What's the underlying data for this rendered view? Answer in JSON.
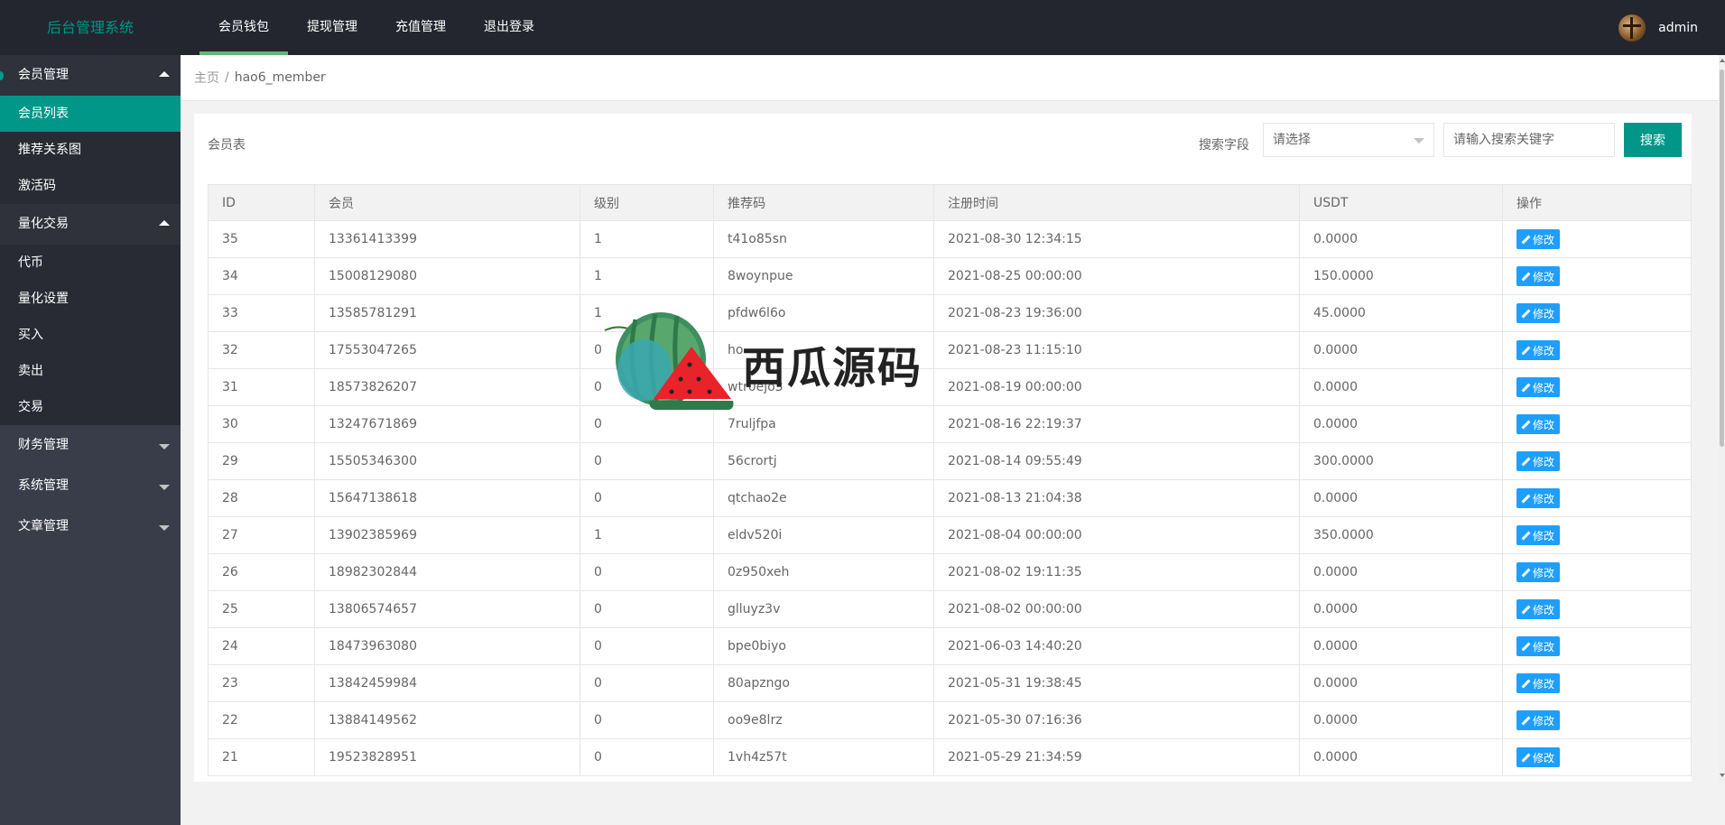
{
  "app": {
    "title": "后台管理系统"
  },
  "nav": {
    "items": [
      {
        "label": "会员钱包"
      },
      {
        "label": "提现管理"
      },
      {
        "label": "充值管理"
      },
      {
        "label": "退出登录"
      }
    ]
  },
  "user": {
    "name": "admin"
  },
  "sidebar": {
    "groups": [
      {
        "label": "会员管理",
        "items": [
          {
            "label": "会员列表"
          },
          {
            "label": "推荐关系图"
          },
          {
            "label": "激活码"
          }
        ]
      },
      {
        "label": "量化交易",
        "items": [
          {
            "label": "代币"
          },
          {
            "label": "量化设置"
          },
          {
            "label": "买入"
          },
          {
            "label": "卖出"
          },
          {
            "label": "交易"
          }
        ]
      },
      {
        "label": "财务管理"
      },
      {
        "label": "系统管理"
      },
      {
        "label": "文章管理"
      }
    ]
  },
  "breadcrumb": {
    "home": "主页",
    "separator": "/",
    "current": "hao6_member"
  },
  "card": {
    "title": "会员表",
    "search_label": "搜索字段",
    "select_value": "请选择",
    "search_placeholder": "请输入搜索关键字",
    "search_button": "搜索"
  },
  "table": {
    "headers": [
      "ID",
      "会员",
      "级别",
      "推荐码",
      "注册时间",
      "USDT",
      "操作"
    ],
    "edit_label": "修改",
    "rows": [
      [
        "35",
        "13361413399",
        "1",
        "t41o85sn",
        "2021-08-30 12:34:15",
        "0.0000"
      ],
      [
        "34",
        "15008129080",
        "1",
        "8woynpue",
        "2021-08-25 00:00:00",
        "150.0000"
      ],
      [
        "33",
        "13585781291",
        "1",
        "pfdw6l6o",
        "2021-08-23 19:36:00",
        "45.0000"
      ],
      [
        "32",
        "17553047265",
        "0",
        "ho",
        "2021-08-23 11:15:10",
        "0.0000"
      ],
      [
        "31",
        "18573826207",
        "0",
        "wtr0ejo3",
        "2021-08-19 00:00:00",
        "0.0000"
      ],
      [
        "30",
        "13247671869",
        "0",
        "7ruljfpa",
        "2021-08-16 22:19:37",
        "0.0000"
      ],
      [
        "29",
        "15505346300",
        "0",
        "56crortj",
        "2021-08-14 09:55:49",
        "300.0000"
      ],
      [
        "28",
        "15647138618",
        "0",
        "qtchao2e",
        "2021-08-13 21:04:38",
        "0.0000"
      ],
      [
        "27",
        "13902385969",
        "1",
        "eldv520i",
        "2021-08-04 00:00:00",
        "350.0000"
      ],
      [
        "26",
        "18982302844",
        "0",
        "0z950xeh",
        "2021-08-02 19:11:35",
        "0.0000"
      ],
      [
        "25",
        "13806574657",
        "0",
        "glluyz3v",
        "2021-08-02 00:00:00",
        "0.0000"
      ],
      [
        "24",
        "18473963080",
        "0",
        "bpe0biyo",
        "2021-06-03 14:40:20",
        "0.0000"
      ],
      [
        "23",
        "13842459984",
        "0",
        "80apzngo",
        "2021-05-31 19:38:45",
        "0.0000"
      ],
      [
        "22",
        "13884149562",
        "0",
        "oo9e8lrz",
        "2021-05-30 07:16:36",
        "0.0000"
      ],
      [
        "21",
        "19523828951",
        "0",
        "1vh4z57t",
        "2021-05-29 21:34:59",
        "0.0000"
      ]
    ]
  },
  "watermark": {
    "text": "西瓜源码"
  },
  "colors": {
    "accent": "#009688",
    "header_bg": "#23262e",
    "sidebar_bg": "#393d49",
    "edit_button": "#1e9fff",
    "nav_underline": "#5fb878"
  }
}
